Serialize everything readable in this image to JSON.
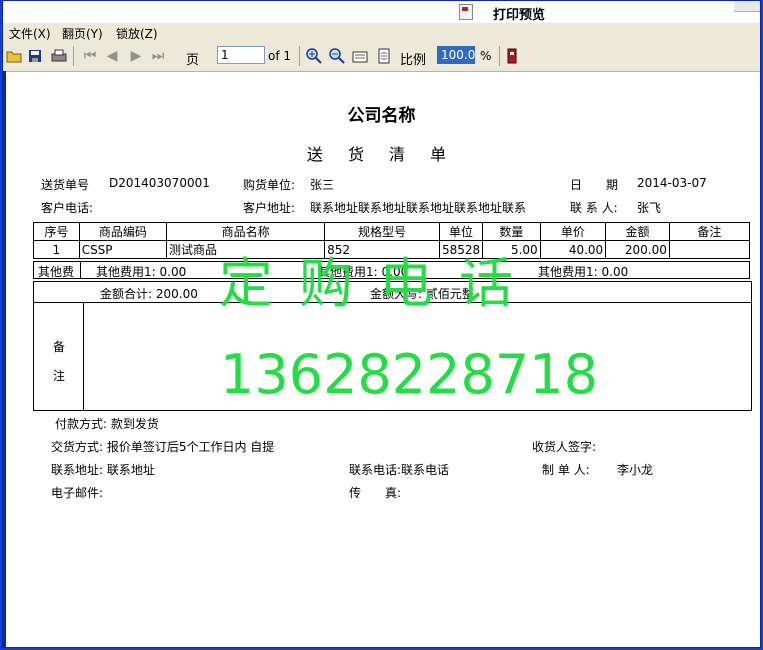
{
  "window": {
    "title": "打印预览"
  },
  "menu": [
    "文件(X)",
    "翻页(Y)",
    "锁放(Z)"
  ],
  "toolbar": {
    "page_label": "页",
    "page_value": "1",
    "page_of": "of 1",
    "zoom_label": "比例",
    "zoom_value": "100.0",
    "zoom_unit": "%"
  },
  "doc": {
    "company": "公司名称",
    "title": "送 货 清 单",
    "header": {
      "order_no_label": "送货单号",
      "order_no": "D201403070001",
      "buyer_label": "购货单位:",
      "buyer": "张三",
      "date_label": "日　　期",
      "date": "2014-03-07",
      "phone_label": "客户电话:",
      "address_label": "客户地址:",
      "address": "联系地址联系地址联系地址联系地址联系",
      "contact_label": "联 系 人:",
      "contact": "张飞"
    },
    "table": {
      "columns": [
        "序号",
        "商品编码",
        "商品名称",
        "规格型号",
        "单位",
        "数量",
        "单价",
        "金额",
        "备注"
      ],
      "rows": [
        [
          "1",
          "CSSP",
          "测试商品",
          "852",
          "58528",
          "5.00",
          "40.00",
          "200.00",
          ""
        ]
      ]
    },
    "other_fees": {
      "label": "其他费",
      "fee1": "其他费用1: 0.00",
      "fee2": "其他费用1: 0.00",
      "fee3": "其他费用1: 0.00"
    },
    "totals": {
      "sum": "金额合计: 200.00",
      "uppercase": "金额大写: 贰佰元整"
    },
    "remarks": {
      "label1": "备",
      "label2": "注"
    },
    "footer": {
      "payment": "付款方式: 款到发货",
      "delivery": "交货方式: 报价单签订后5个工作日内 自提",
      "receiver_sign": "收货人签字:",
      "contact_address": "联系地址: 联系地址",
      "contact_phone": "联系电话:联系电话",
      "maker_label": "制 单 人:",
      "maker": "李小龙",
      "email": "电子邮件:",
      "fax": "传　　真:"
    }
  },
  "watermark": {
    "line1": "定购电话",
    "line2": "13628228718",
    "color": "#22dd44"
  }
}
